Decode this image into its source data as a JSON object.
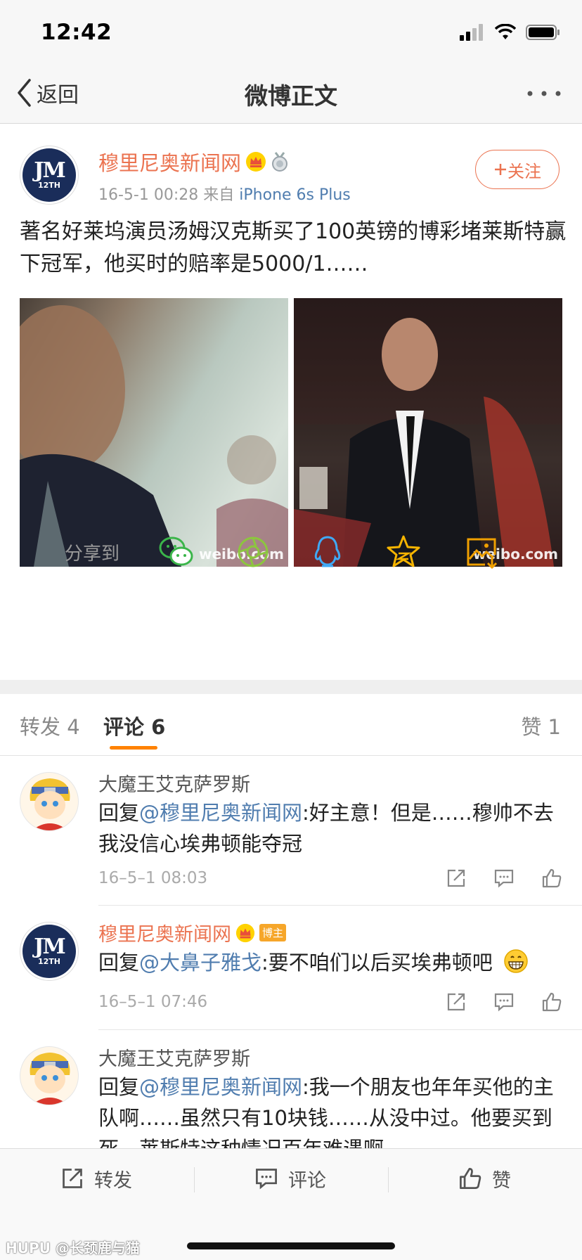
{
  "status_bar": {
    "time": "12:42"
  },
  "nav": {
    "back_label": "返回",
    "title": "微博正文"
  },
  "post": {
    "author": "穆里尼奥新闻网",
    "date": "16-5-1 00:28",
    "source_prefix": "来自",
    "source": "iPhone 6s Plus",
    "follow_label": "关注",
    "text": "著名好莱坞演员汤姆汉克斯买了100英镑的博彩堵莱斯特赢下冠军，他买时的赔率是5000/1……",
    "images": [
      {
        "watermark": "weibo.com"
      },
      {
        "watermark": "weibo.com"
      }
    ],
    "avatar_mono": "JM",
    "avatar_sub": "12TH"
  },
  "share": {
    "label": "分享到",
    "icons": [
      "wechat-icon",
      "moments-icon",
      "qq-icon",
      "qzone-icon",
      "save-image-icon"
    ]
  },
  "tabs": {
    "repost": "转发 4",
    "comment": "评论 6",
    "like": "赞 1"
  },
  "comments": [
    {
      "name": "大魔王艾克萨罗斯",
      "prefix": "回复",
      "mention": "@穆里尼奥新闻网",
      "text": ":好主意！但是……穆帅不去我没信心埃弗顿能夺冠",
      "time": "16–5–1 08:03"
    },
    {
      "name": "穆里尼奥新闻网",
      "badge": "博主",
      "prefix": "回复",
      "mention": "@大鼻子雅戈",
      "text": ":要不咱们以后买埃弗顿吧",
      "time": "16–5–1 07:46"
    },
    {
      "name": "大魔王艾克萨罗斯",
      "prefix": "回复",
      "mention": "@穆里尼奥新闻网",
      "text": ":我一个朋友也年年买他的主队啊……虽然只有10块钱……从没中过。他要买到死，莱斯特这种情况百年难遇啊"
    }
  ],
  "bottom_bar": {
    "repost": "转发",
    "comment": "评论",
    "like": "赞"
  },
  "footer_watermark": "HUPU @长颈鹿与猫",
  "colors": {
    "accent": "#eb7350",
    "link": "#507daf",
    "tab_underline": "#ff8200"
  }
}
